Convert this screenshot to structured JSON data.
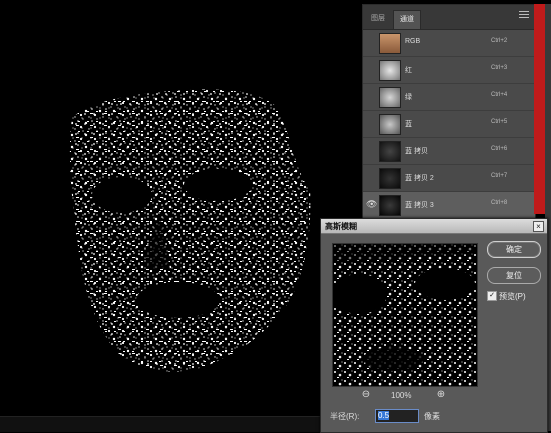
{
  "panel": {
    "tabs": [
      "图层",
      "通道"
    ],
    "channels": [
      {
        "name": "RGB",
        "shortcut": "Ctrl+2",
        "thumb": "color",
        "eye": ""
      },
      {
        "name": "红",
        "shortcut": "Ctrl+3",
        "thumb": "gray",
        "eye": ""
      },
      {
        "name": "绿",
        "shortcut": "Ctrl+4",
        "thumb": "gray",
        "eye": ""
      },
      {
        "name": "蓝",
        "shortcut": "Ctrl+5",
        "thumb": "gray",
        "eye": ""
      },
      {
        "name": "蓝 拷贝",
        "shortcut": "Ctrl+6",
        "thumb": "dark",
        "eye": ""
      },
      {
        "name": "蓝 拷贝 2",
        "shortcut": "Ctrl+7",
        "thumb": "dark",
        "eye": ""
      },
      {
        "name": "蓝 拷贝 3",
        "shortcut": "Ctrl+8",
        "thumb": "dark",
        "eye": "👁"
      }
    ]
  },
  "dialog": {
    "title": "高斯模糊",
    "close": "×",
    "ok": "确定",
    "reset": "复位",
    "preview_label": "预览(P)",
    "preview_checked": "✓",
    "zoom_level": "100%",
    "zoom_out": "⊖",
    "zoom_in": "⊕",
    "radius_label": "半径(R):",
    "radius_value": "0.5",
    "radius_unit": "像素"
  },
  "colors": {
    "accent_red": "#c01b1b",
    "selection_blue": "#3778d6"
  }
}
